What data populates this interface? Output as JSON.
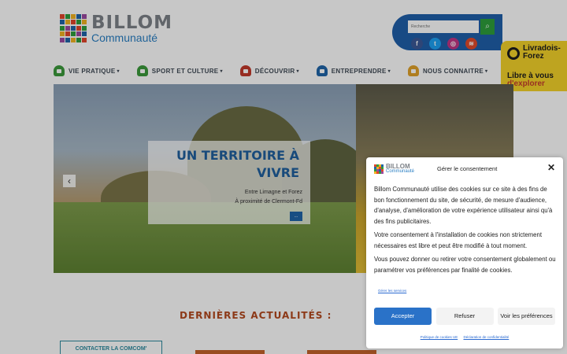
{
  "header": {
    "logo_title": "BILLOM",
    "logo_subtitle": "Communauté",
    "search_placeholder": "Recherche",
    "search_icon": "magnifier-icon",
    "socials": [
      {
        "name": "facebook-icon",
        "glyph": "f",
        "color": "#3b5998"
      },
      {
        "name": "twitter-icon",
        "glyph": "t",
        "color": "#1da1f2"
      },
      {
        "name": "instagram-icon",
        "glyph": "◎",
        "color": "#c13584"
      },
      {
        "name": "rss-icon",
        "glyph": "≋",
        "color": "#e0492b"
      }
    ],
    "partner": {
      "name_line1": "Livradois-",
      "name_line2": "Forez",
      "slogan_line1": "Libre à vous",
      "slogan_line2": "d'explorer"
    }
  },
  "nav": {
    "items": [
      {
        "label": "VIE PRATIQUE",
        "icon": "house-icon",
        "color": "#3c9a3c"
      },
      {
        "label": "SPORT ET CULTURE",
        "icon": "sport-icon",
        "color": "#3c9a3c"
      },
      {
        "label": "DÉCOUVRIR",
        "icon": "eye-icon",
        "color": "#c2392b"
      },
      {
        "label": "ENTREPRENDRE",
        "icon": "briefcase-icon",
        "color": "#1f64a8"
      },
      {
        "label": "NOUS CONNAITRE",
        "icon": "star-icon",
        "color": "#e0a22a"
      }
    ],
    "caret": "▾"
  },
  "hero": {
    "title_line1": "UN TERRITOIRE À",
    "title_line2": "VIVRE",
    "line1": "Entre Limagne et Forez",
    "line2": "À proximité de Clermont-Fd",
    "more_button": "...",
    "prev_arrow": "‹"
  },
  "news": {
    "title": "DERNIÈRES ACTUALITÉS :",
    "contact_button": "CONTACTER LA COMCOM'"
  },
  "cookie": {
    "logo_title": "BILLOM",
    "logo_subtitle": "Communauté",
    "heading": "Gérer le consentement",
    "close": "✕",
    "paragraph1": "Billom Communauté utilise des cookies sur ce site à des fins de bon fonctionnement du site, de sécurité, de mesure d'audience, d'analyse, d'amélioration de votre expérience utilisateur ainsi qu'à des fins publicitaires.",
    "paragraph2": "Votre consentement à l'installation de cookies non strictement nécessaires est libre et peut être modifié à tout moment.",
    "paragraph3": "Vous pouvez donner ou retirer votre consentement globalement ou paramétrer vos préférences par finalité de cookies.",
    "prefs_link": "Gérer les services",
    "accept": "Accepter",
    "refuse": "Refuser",
    "view_prefs": "Voir les préférences",
    "footer_link1": "Politique de cookies UE",
    "footer_link2": "Déclaration de confidentialité"
  },
  "colors": {
    "brand_blue": "#1f5faa",
    "accent_green": "#2d9e3c",
    "news_title": "#b44a1f",
    "accept_button": "#2a72c8",
    "partner_yellow": "#f4d22a"
  }
}
